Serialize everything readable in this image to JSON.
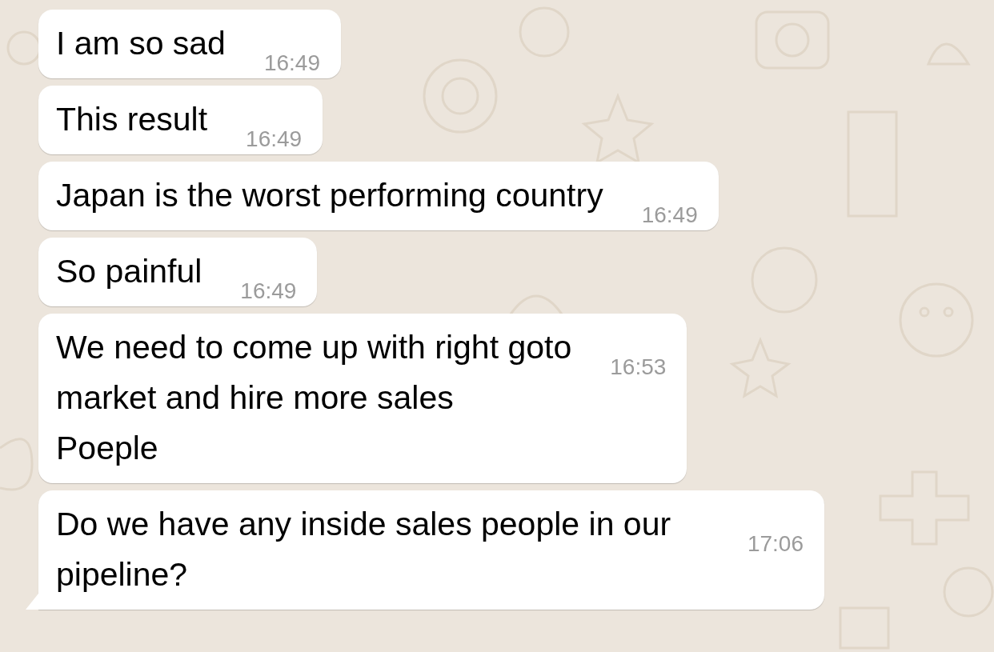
{
  "messages": [
    {
      "text": "I am so sad",
      "time": "16:49",
      "tail": false
    },
    {
      "text": "This result",
      "time": "16:49",
      "tail": false
    },
    {
      "text": "Japan is the worst performing country",
      "time": "16:49",
      "tail": false
    },
    {
      "text": "So painful",
      "time": "16:49",
      "tail": false
    },
    {
      "text": "We need to come up with right goto\nmarket and hire more sales\nPoeple",
      "time": "16:53",
      "tail": false
    },
    {
      "text": "Do we have any inside sales people in our pipeline?",
      "time": "17:06",
      "tail": true
    }
  ]
}
